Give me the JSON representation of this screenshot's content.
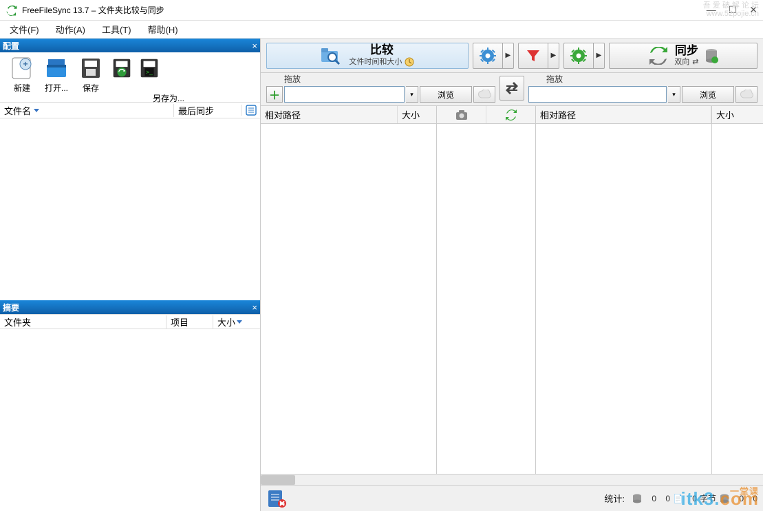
{
  "title": "FreeFileSync 13.7 – 文件夹比较与同步",
  "watermark_top": {
    "line1": "吾 爱 破 解 论 坛",
    "line2": "www.52pojie.cn"
  },
  "menu": [
    "文件(F)",
    "动作(A)",
    "工具(T)",
    "帮助(H)"
  ],
  "config_panel": {
    "title": "配置",
    "buttons": {
      "new": "新建",
      "open": "打开...",
      "save": "保存",
      "saveas": "另存为..."
    },
    "list_headers": {
      "filename": "文件名",
      "last_sync": "最后同步"
    }
  },
  "summary_panel": {
    "title": "摘要",
    "headers": {
      "folder": "文件夹",
      "items": "项目",
      "size": "大小"
    }
  },
  "actions": {
    "compare": {
      "label": "比较",
      "sublabel": "文件时间和大小"
    },
    "sync": {
      "label": "同步",
      "sublabel": "双向"
    }
  },
  "folders": {
    "drag_label": "拖放",
    "browse": "浏览",
    "left_path": "",
    "right_path": ""
  },
  "grid": {
    "rel_path": "相对路径",
    "size": "大小"
  },
  "status": {
    "label": "统计:",
    "v1": "0",
    "v2": "0",
    "bytes_label": "字节",
    "v3": "0",
    "v4": "0",
    "v5": "0",
    "v6": "0"
  },
  "watermark_bottom": {
    "text": "itk3",
    "dot": ".",
    "com": "com",
    "sub": "一堂课"
  }
}
